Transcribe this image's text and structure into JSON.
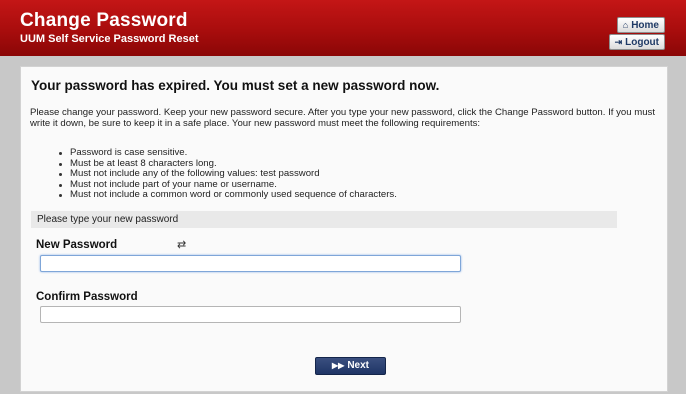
{
  "header": {
    "title": "Change Password",
    "subtitle": "UUM Self Service Password Reset",
    "home_label": "Home",
    "logout_label": "Logout",
    "home_icon": "⌂",
    "logout_icon": "⇥"
  },
  "panel": {
    "title": "Your password has expired. You must set a new password now.",
    "intro": "Please change your password. Keep your new password secure. After you type your new password, click the Change Password button. If you must write it down, be sure to keep it in a safe place. Your new password must meet the following requirements:",
    "requirements": [
      "Password is case sensitive.",
      "Must be at least 8 characters long.",
      "Must not include any of the following values: test password",
      "Must not include part of your name or username.",
      "Must not include a common word or commonly used sequence of characters."
    ],
    "prompt": "Please type your new password"
  },
  "form": {
    "new_label": "New Password",
    "new_value": "",
    "toggle_icon": "⇄",
    "confirm_label": "Confirm Password",
    "confirm_value": "",
    "next_label": "Next",
    "next_icon": "▶▶"
  },
  "colors": {
    "header_red": "#b01010",
    "button_navy": "#2a3f70"
  }
}
